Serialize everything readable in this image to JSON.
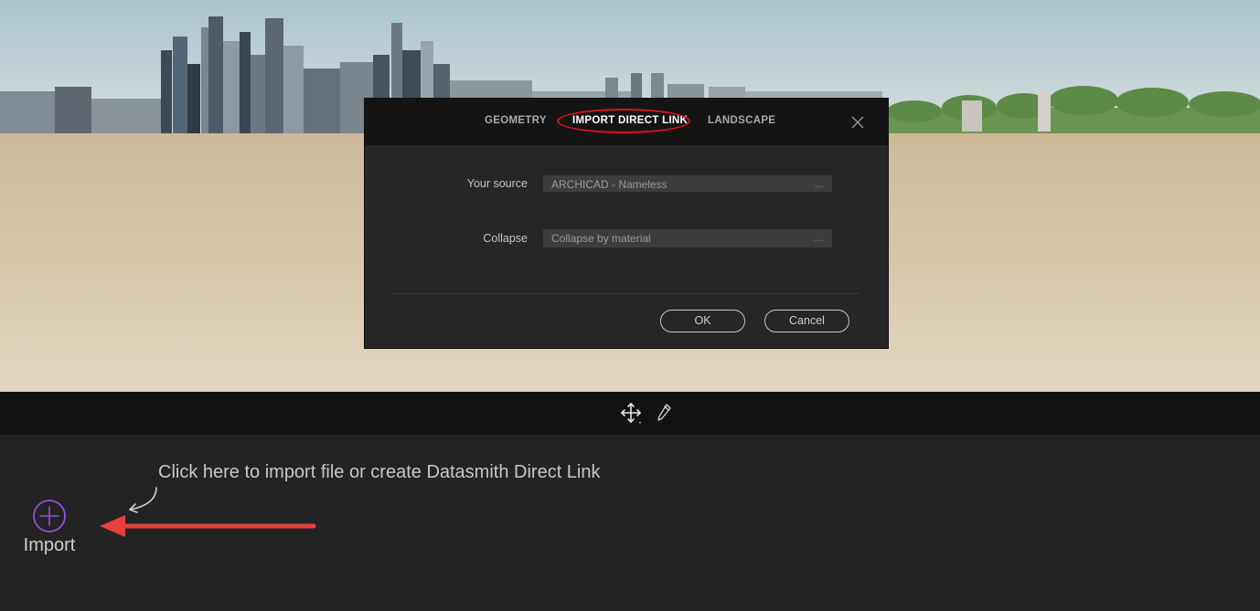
{
  "dialog": {
    "tabs": [
      {
        "label": "GEOMETRY",
        "active": false
      },
      {
        "label": "IMPORT DIRECT LINK",
        "active": true
      },
      {
        "label": "LANDSCAPE",
        "active": false
      }
    ],
    "fields": {
      "source": {
        "label": "Your source",
        "value": "ARCHICAD - Nameless",
        "more": "..."
      },
      "collapse": {
        "label": "Collapse",
        "value": "Collapse by material",
        "more": "..."
      }
    },
    "buttons": {
      "ok": "OK",
      "cancel": "Cancel"
    },
    "highlight_color": "#d6151b"
  },
  "toolbar": {
    "icons": [
      "move-icon",
      "eyedropper-icon"
    ]
  },
  "bottom_panel": {
    "hint": "Click here to import file or create Datasmith Direct Link",
    "import_label": "Import",
    "accent_color": "#9b4fd6",
    "arrow_color": "#e8403f"
  }
}
